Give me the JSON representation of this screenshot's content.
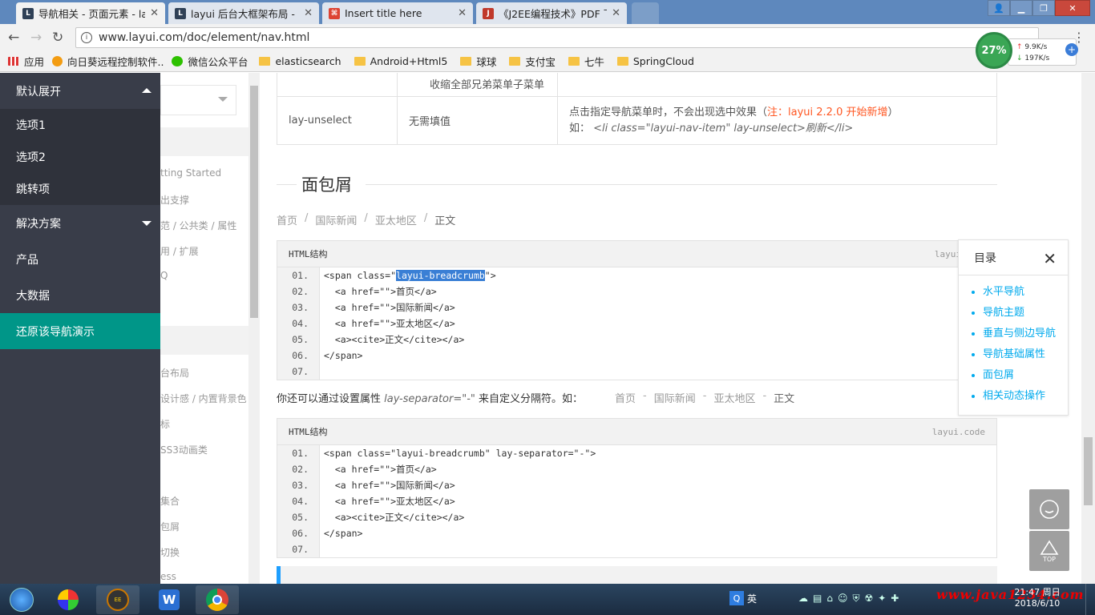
{
  "browser": {
    "tabs": [
      {
        "title": "导航相关 - 页面元素 - la",
        "favicon": "layui-icon",
        "active": true
      },
      {
        "title": "layui 后台大框架布局 - ",
        "favicon": "layui-icon",
        "active": false
      },
      {
        "title": "Insert title here",
        "favicon": "document-icon",
        "active": false
      },
      {
        "title": "《J2EE编程技术》PDF 下",
        "favicon": "j-icon",
        "active": false
      }
    ],
    "url": "www.layui.com/doc/element/nav.html",
    "bookmarks": [
      {
        "label": "应用",
        "icon": "apps-icon"
      },
      {
        "label": "向日葵远程控制软件..",
        "icon": "sunflower-icon"
      },
      {
        "label": "微信公众平台",
        "icon": "wechat-icon"
      },
      {
        "label": "elasticsearch",
        "icon": "folder-icon"
      },
      {
        "label": "Android+Html5",
        "icon": "folder-icon"
      },
      {
        "label": "球球",
        "icon": "folder-icon"
      },
      {
        "label": "支付宝",
        "icon": "folder-icon"
      },
      {
        "label": "七牛",
        "icon": "folder-icon"
      },
      {
        "label": "SpringCloud",
        "icon": "folder-icon"
      }
    ],
    "speed": {
      "percent": "27%",
      "up": "9.9K/s",
      "down": "197K/s"
    }
  },
  "sidenav": {
    "group1": "默认展开",
    "sub_items": [
      "选项1",
      "选项2",
      "跳转项"
    ],
    "items": [
      "解决方案",
      "产品",
      "大数据",
      "还原该导航演示"
    ]
  },
  "leftnav_partial": [
    "tting Started",
    "出支撑",
    "范 / 公共类 / 属性",
    "用 / 扩展",
    "Q",
    "台布局",
    "设计感 / 内置背景色",
    "标",
    "SS3动画类",
    "集合",
    "包屑",
    "切换",
    "ess"
  ],
  "attr_table": {
    "row0_desc": "收缩全部兄弟菜单子菜单",
    "row1_attr": "lay-unselect",
    "row1_value": "无需填值",
    "row1_desc": "点击指定导航菜单时，不会出现选中效果（",
    "row1_note": "注：layui 2.2.0 开始新增",
    "row1_desc_end": "）",
    "row1_example_prefix": "如：",
    "row1_example": "<li class=\"layui-nav-item\" lay-unselect>刷新</li>"
  },
  "section": {
    "title": "面包屑",
    "breadcrumb": [
      "首页",
      "国际新闻",
      "亚太地区",
      "正文"
    ],
    "breadcrumb_sep": "/",
    "code1_title": "HTML结构",
    "code1_lang": "layui",
    "code1_lines": [
      {
        "num": "01.",
        "pre": "<span class=\"",
        "hl": "layui-breadcrumb",
        "post": "\">"
      },
      {
        "num": "02.",
        "pre": "  <a href=\"\">首页</a>",
        "hl": "",
        "post": ""
      },
      {
        "num": "03.",
        "pre": "  <a href=\"\">国际新闻</a>",
        "hl": "",
        "post": ""
      },
      {
        "num": "04.",
        "pre": "  <a href=\"\">亚太地区</a>",
        "hl": "",
        "post": ""
      },
      {
        "num": "05.",
        "pre": "  <a><cite>正文</cite></a>",
        "hl": "",
        "post": ""
      },
      {
        "num": "06.",
        "pre": "</span>",
        "hl": "",
        "post": ""
      },
      {
        "num": "07.",
        "pre": "",
        "hl": "",
        "post": ""
      }
    ],
    "sep_note_prefix": "你还可以通过设置属性",
    "sep_note_attr": "lay-separator=\"-\"",
    "sep_note_suffix": "来自定义分隔符。如：",
    "breadcrumb2_sep": "-",
    "code2_title": "HTML结构",
    "code2_lang": "layui.code",
    "code2_lines": [
      {
        "num": "01.",
        "text": "<span class=\"layui-breadcrumb\" lay-separator=\"-\">"
      },
      {
        "num": "02.",
        "text": "  <a href=\"\">首页</a>"
      },
      {
        "num": "03.",
        "text": "  <a href=\"\">国际新闻</a>"
      },
      {
        "num": "04.",
        "text": "  <a href=\"\">亚太地区</a>"
      },
      {
        "num": "05.",
        "text": "  <a><cite>正文</cite></a>"
      },
      {
        "num": "06.",
        "text": "</span>"
      },
      {
        "num": "07.",
        "text": ""
      }
    ]
  },
  "toc": {
    "title": "目录",
    "items": [
      "水平导航",
      "导航主题",
      "垂直与侧边导航",
      "导航基础属性",
      "面包屑",
      "相关动态操作"
    ]
  },
  "float_buttons": {
    "top_label": "TOP"
  },
  "taskbar": {
    "ime": "英",
    "time": "21:47 周日",
    "date": "2018/6/10",
    "watermark": "www.java1234.com",
    "apps": [
      "windows-start-icon",
      "app-icon",
      "java-ee-ide-icon",
      "wps-icon",
      "chrome-icon"
    ]
  }
}
